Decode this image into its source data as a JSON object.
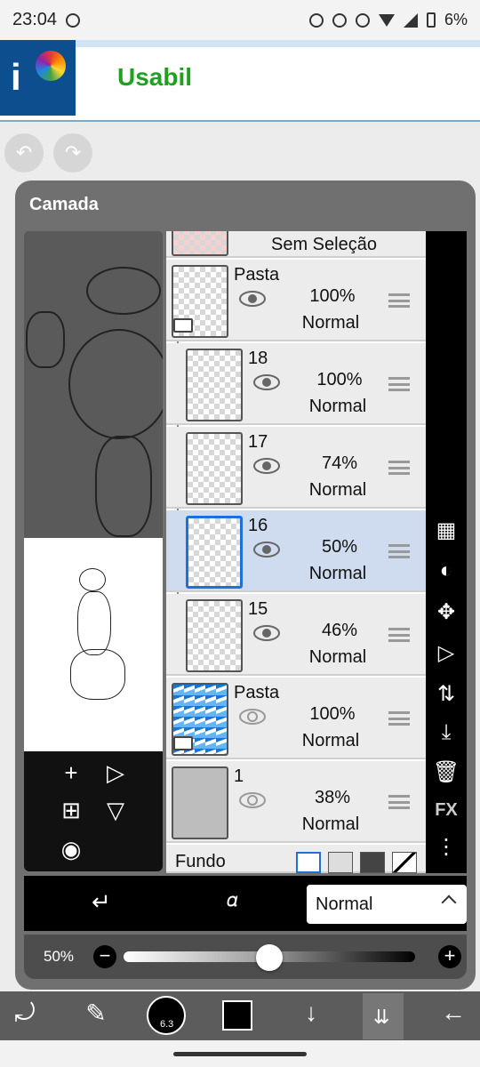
{
  "status_bar": {
    "time": "23:04",
    "battery": "6%"
  },
  "ad": {
    "title": "Usabil"
  },
  "panel": {
    "title": "Camada"
  },
  "layers": [
    {
      "name": "Sem Seleção",
      "opacity": "",
      "blend": ""
    },
    {
      "name": "Pasta",
      "opacity": "100%",
      "blend": "Normal",
      "visible": true,
      "folder": true
    },
    {
      "name": "18",
      "opacity": "100%",
      "blend": "Normal",
      "visible": true
    },
    {
      "name": "17",
      "opacity": "74%",
      "blend": "Normal",
      "visible": true
    },
    {
      "name": "16",
      "opacity": "50%",
      "blend": "Normal",
      "visible": true,
      "selected": true
    },
    {
      "name": "15",
      "opacity": "46%",
      "blend": "Normal",
      "visible": true
    },
    {
      "name": "Pasta",
      "opacity": "100%",
      "blend": "Normal",
      "visible": false,
      "folder": true
    },
    {
      "name": "1",
      "opacity": "38%",
      "blend": "Normal",
      "visible": false
    },
    {
      "name": "Fundo"
    }
  ],
  "sidebar_tools": {
    "fx": "FX"
  },
  "blend_bar": {
    "mode": "Normal"
  },
  "opacity_bar": {
    "label": "50%",
    "value": 0.5
  },
  "toolbar": {
    "brush_size": "6.3"
  }
}
